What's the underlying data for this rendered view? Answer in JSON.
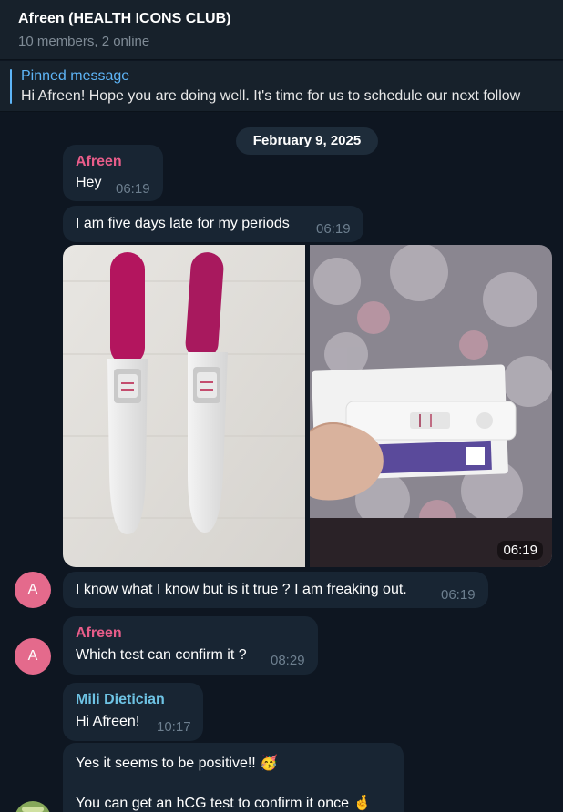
{
  "header": {
    "title": "Afreen (HEALTH ICONS CLUB)",
    "subtitle": "10 members, 2 online"
  },
  "pinned": {
    "label": "Pinned message",
    "text": "Hi Afreen! Hope you are doing well.   It's time for us to schedule our next follow"
  },
  "date_divider": "February 9, 2025",
  "messages": [
    {
      "sender": "Afreen",
      "text": "Hey",
      "time": "06:19"
    },
    {
      "text": "I am five days late for my periods",
      "time": "06:19"
    },
    {
      "type": "photos",
      "time": "06:19"
    },
    {
      "avatar": "A",
      "text": "I know what I know but is it true ? I am freaking out.",
      "time": "06:19"
    },
    {
      "avatar": "A",
      "sender": "Afreen",
      "text": "Which test can confirm it ?",
      "time": "08:29"
    },
    {
      "sender": "Mili Dietician",
      "text": "Hi Afreen!",
      "time": "10:17"
    },
    {
      "line1": "Yes it seems to be positive!! 🥳",
      "line2": "You can get an hCG test to confirm it once 🤞"
    }
  ],
  "colors": {
    "background": "#0e1621",
    "header": "#17212b",
    "bubble": "#182533",
    "accent_link": "#5eb5f7",
    "afreen_name": "#e95d8a",
    "mili_name": "#6ec3e4",
    "avatar": "#e46a8c"
  },
  "icons": {
    "photo_1": "pregnancy-tests-photo",
    "photo_2": "pregnancy-test-in-hand-photo",
    "party_emoji": "partying-face-emoji",
    "crossed_fingers_emoji": "crossed-fingers-emoji"
  }
}
